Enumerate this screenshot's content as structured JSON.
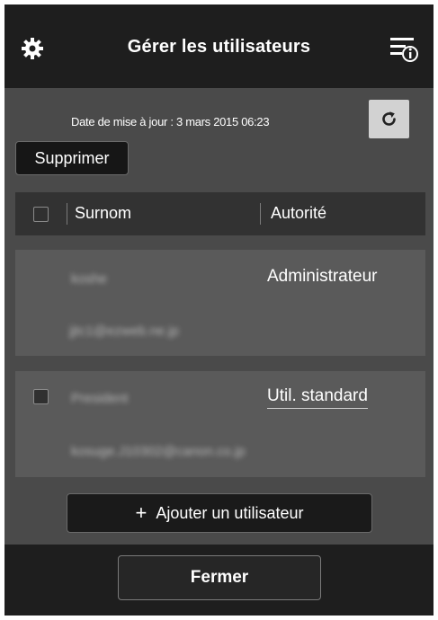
{
  "header": {
    "title": "Gérer les utilisateurs",
    "settings_icon": "gear-icon",
    "info_icon": "menu-info-icon"
  },
  "toolbar": {
    "updated_text": "Date de mise à jour : 3 mars 2015 06:23",
    "refresh_icon": "refresh-icon",
    "delete_label": "Supprimer"
  },
  "table": {
    "columns": [
      "Surnom",
      "Autorité"
    ],
    "rows": [
      {
        "nickname": "koshe",
        "email": "jjtc1@ezweb.ne.jp",
        "authority": "Administrateur",
        "selectable": false
      },
      {
        "nickname": "President",
        "email": "kosuge.J10302@canon.co.jp",
        "authority": "Util. standard",
        "selectable": true
      }
    ]
  },
  "actions": {
    "add_user_label": "Ajouter un utilisateur",
    "add_icon": "+",
    "close_label": "Fermer"
  },
  "colors": {
    "background": "#1c1c1c",
    "content": "#4a4a4a",
    "row": "#5a5a5a",
    "refresh_button": "#d2d2d2"
  }
}
